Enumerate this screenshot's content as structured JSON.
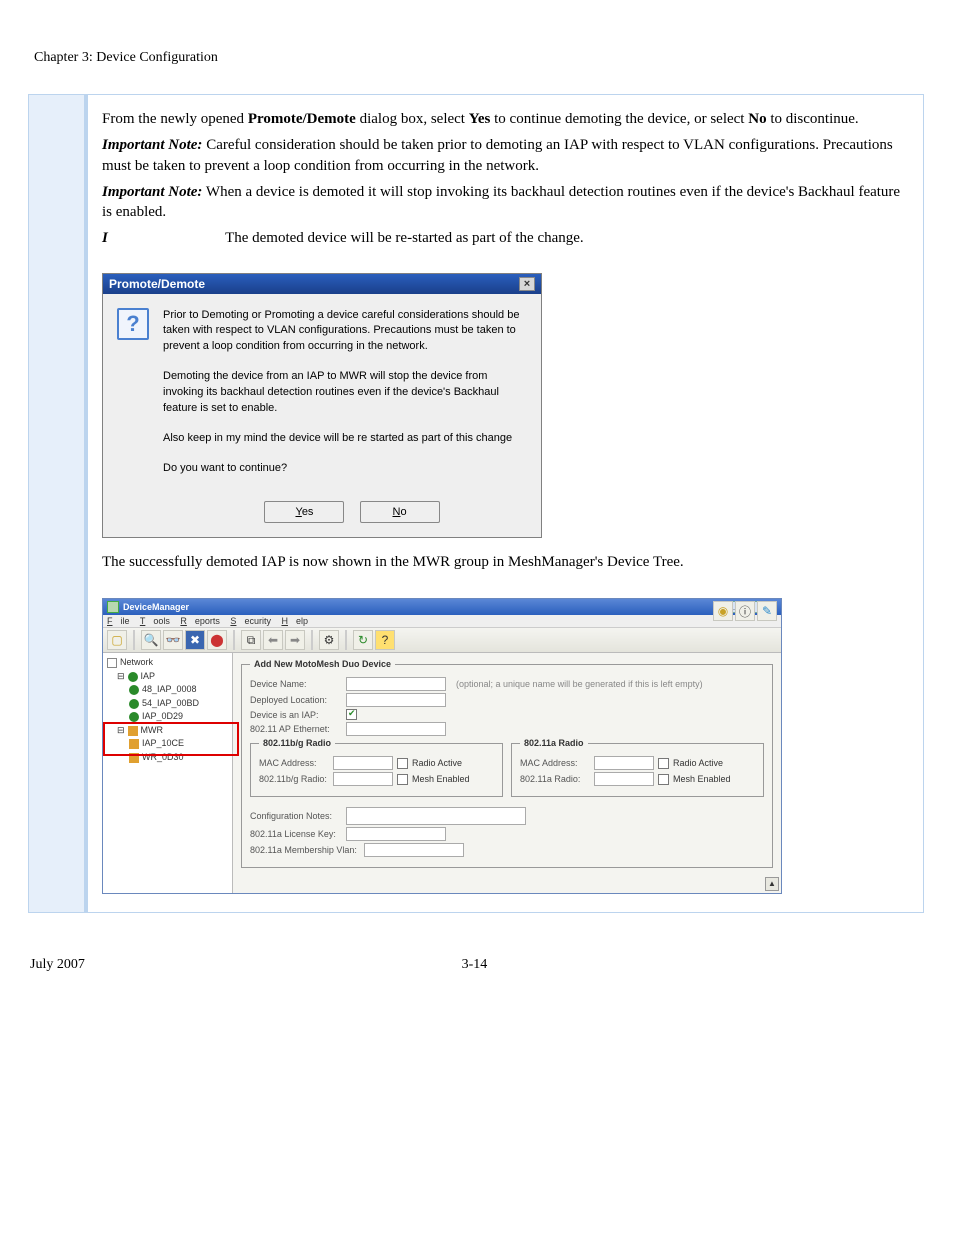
{
  "chapter_header": "Chapter 3: Device Configuration",
  "body": {
    "p1a": "From the newly opened ",
    "p1b": "Promote/Demote",
    "p1c": " dialog box, select ",
    "p1d": "Yes",
    "p1e": " to continue demoting the device, or select ",
    "p1f": "No",
    "p1g": " to discontinue.",
    "note1_lead": "Important Note:",
    "note1": " Careful consideration should be taken prior to demoting an IAP with respect to VLAN configurations. Precautions must be taken to prevent a loop condition from occurring in the network.",
    "note2_lead": "Important Note:",
    "note2": " When a device is demoted it will stop invoking its backhaul detection routines even if the device's Backhaul feature is enabled.",
    "note3_lead": "Important Note:",
    "note3": " The demoted device will be re-started as part of the change.",
    "after_dialog": "The successfully demoted IAP is now shown in the MWR group in MeshManager's Device Tree."
  },
  "dialog": {
    "title": "Promote/Demote",
    "p1": "Prior to Demoting or Promoting a device careful considerations should be taken with respect to VLAN configurations. Precautions must be taken to prevent a loop condition from occurring in the network.",
    "p2": "Demoting the device from an IAP to MWR will stop the device from invoking its backhaul detection routines even if the device's Backhaul feature is set to enable.",
    "p3": "Also keep in my mind the device will be re started as part of this change",
    "p4": "Do you want to continue?",
    "yes": "Yes",
    "no": "No"
  },
  "dm": {
    "title": "DeviceManager",
    "menu": {
      "file": "File",
      "tools": "Tools",
      "reports": "Reports",
      "security": "Security",
      "help": "Help"
    },
    "tree": {
      "root": "Network",
      "iap": "IAP",
      "d1": "48_IAP_0008",
      "d2": "54_IAP_00BD",
      "d3": "IAP_0D29",
      "mwr": "MWR",
      "m1": "IAP_10CE",
      "m2": "WR_0D30"
    },
    "form": {
      "fs1_legend": "Add New MotoMesh Duo Device",
      "device_name": "Device Name:",
      "device_hint": "(optional; a unique name will be generated if this is left empty)",
      "deployed": "Deployed Location:",
      "is_iap": "Device is an IAP:",
      "ap_eth": "802.11 AP Ethernet:",
      "bg_legend": "802.11b/g Radio",
      "a_legend": "802.11a Radio",
      "mac": "MAC Address:",
      "radio_active": "Radio Active",
      "mesh_enabled": "Mesh Enabled",
      "bg_radio": "802.11b/g Radio:",
      "a_radio": "802.11a Radio:",
      "conf_notes": "Configuration Notes:",
      "lic_key": "802.11a License Key:",
      "memb_vlan": "802.11a Membership Vlan:"
    }
  },
  "footer": {
    "date": "July 2007",
    "page": "3-14"
  }
}
